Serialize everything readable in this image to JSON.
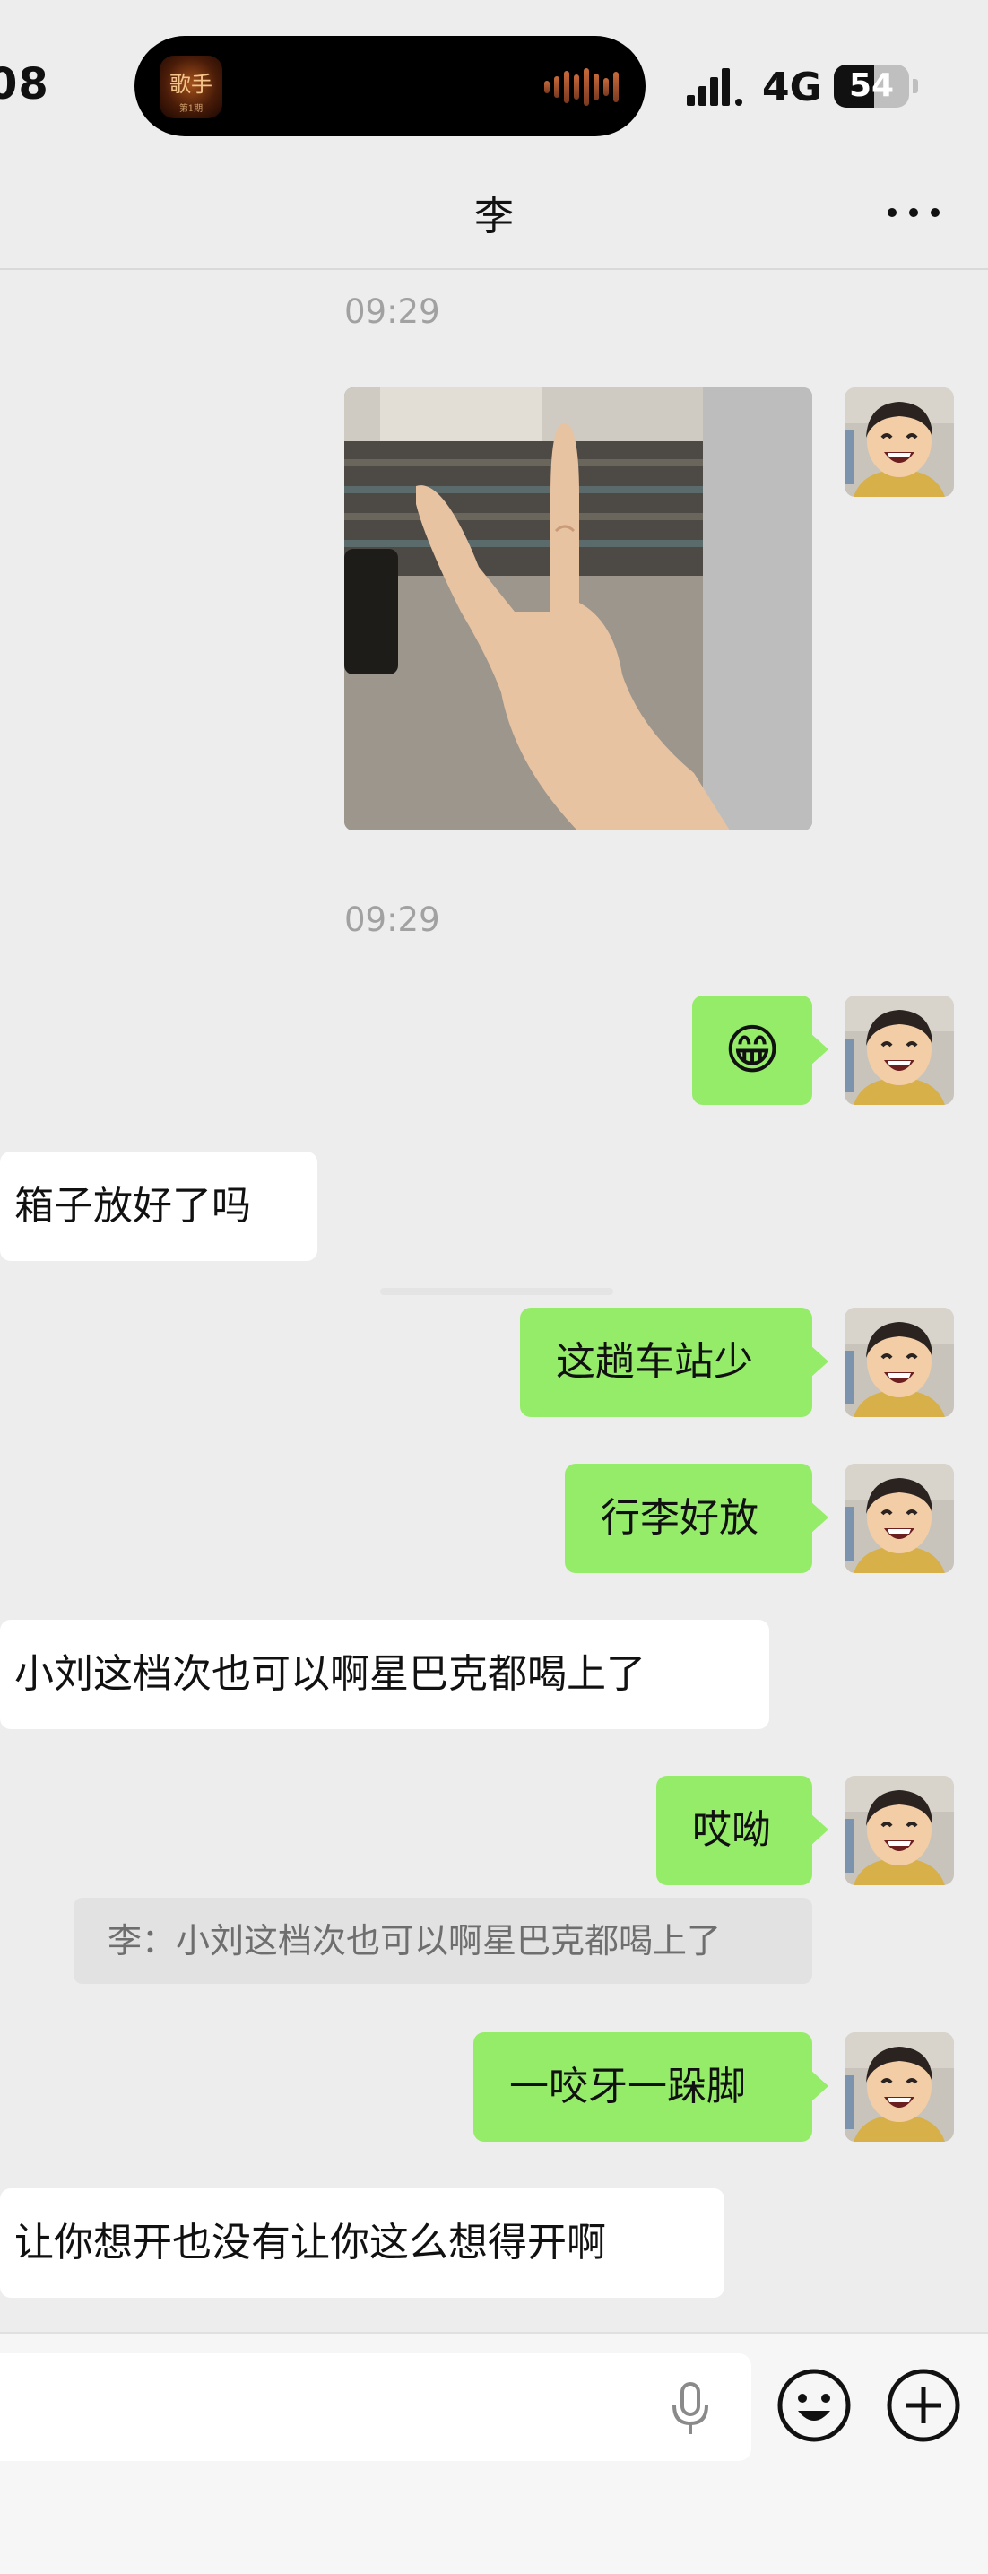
{
  "status_bar": {
    "time": "08",
    "network": "4G",
    "battery": "54",
    "battery_level": 0.54,
    "now_playing_thumb": {
      "title": "歌手",
      "subtitle": "第1期"
    }
  },
  "header": {
    "title": "李",
    "more_icon": "more-dots-icon"
  },
  "messages": [
    {
      "type": "timestamp",
      "text": "09:29"
    },
    {
      "type": "image",
      "side": "right",
      "description_icon": "peace-sign-photo"
    },
    {
      "type": "timestamp",
      "text": "09:29"
    },
    {
      "type": "emoji",
      "side": "right",
      "emoji": "😁"
    },
    {
      "type": "text",
      "side": "left",
      "text": "箱子放好了吗"
    },
    {
      "type": "text",
      "side": "right",
      "text": "这趟车站少"
    },
    {
      "type": "text",
      "side": "right",
      "text": "行李好放"
    },
    {
      "type": "text",
      "side": "left",
      "text": "小刘这档次也可以啊星巴克都喝上了"
    },
    {
      "type": "text",
      "side": "right",
      "text": "哎呦"
    },
    {
      "type": "quote",
      "side": "right",
      "text": "李：小刘这档次也可以啊星巴克都喝上了"
    },
    {
      "type": "text",
      "side": "right",
      "text": "一咬牙一跺脚"
    },
    {
      "type": "text",
      "side": "left",
      "text": "让你想开也没有让你这么想得开啊"
    }
  ],
  "input_bar": {
    "placeholder": "",
    "icons": [
      "microphone-icon",
      "emoji-icon",
      "plus-icon"
    ]
  },
  "colors": {
    "background": "#ededed",
    "sent_bubble": "#95ec69",
    "received_bubble": "#ffffff",
    "timestamp": "#a1a1a1",
    "quote_bg": "#e2e2e2"
  }
}
